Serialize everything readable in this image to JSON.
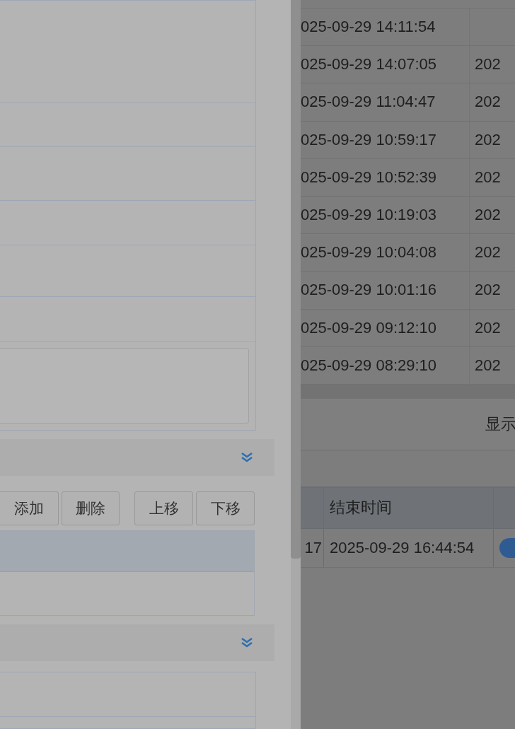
{
  "editor_panel": {
    "toolbar_buttons": [
      {
        "label": "添加"
      },
      {
        "label": "删除"
      },
      {
        "label": "上移"
      },
      {
        "label": "下移"
      }
    ]
  },
  "record_table": {
    "rows": [
      {
        "column_1": "025-09-29 14:11:54"
      },
      {
        "column_1": "025-09-29 14:07:05",
        "column_2": "202"
      },
      {
        "column_1": "025-09-29 11:04:47",
        "column_2": "202"
      },
      {
        "column_1": "025-09-29 10:59:17",
        "column_2": "202"
      },
      {
        "column_1": "025-09-29 10:52:39",
        "column_2": "202"
      },
      {
        "column_1": "025-09-29 10:19:03",
        "column_2": "202"
      },
      {
        "column_1": "025-09-29 10:04:08",
        "column_2": "202"
      },
      {
        "column_1": "025-09-29 10:01:16",
        "column_2": "202"
      },
      {
        "column_1": "025-09-29 09:12:10",
        "column_2": "202"
      },
      {
        "column_1": "025-09-29 08:29:10",
        "column_2": "202"
      }
    ]
  },
  "pagination": {
    "label": "显示"
  },
  "detail_table": {
    "columns": [
      "结束时间"
    ],
    "rows": [
      {
        "column_1": "17",
        "end_time": "2025-09-29 16:44:54"
      }
    ]
  }
}
